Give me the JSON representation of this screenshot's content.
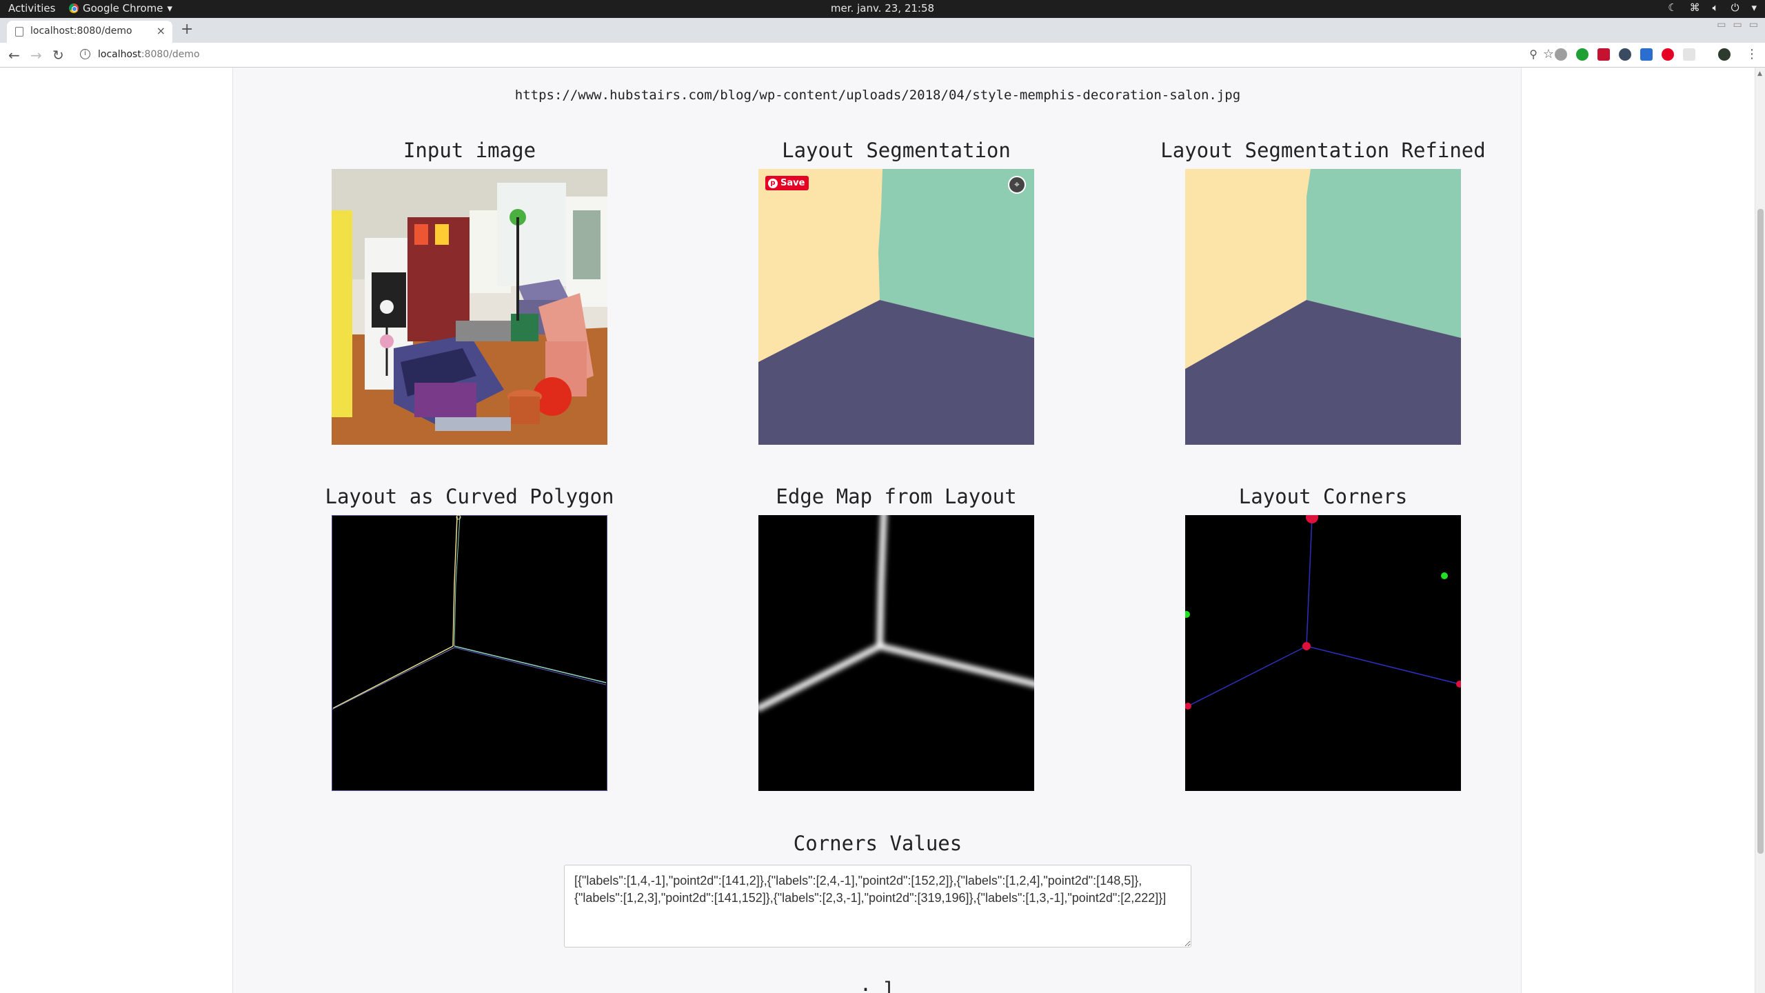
{
  "system_bar": {
    "activities": "Activities",
    "app_name": "Google Chrome",
    "clock": "mer. janv. 23, 21:58"
  },
  "browser": {
    "tab_title": "localhost:8080/demo",
    "url_host": "localhost",
    "url_rest": ":8080/demo"
  },
  "page": {
    "image_url": "https://www.hubstairs.com/blog/wp-content/uploads/2018/04/style-memphis-decoration-salon.jpg",
    "panels": {
      "input": "Input image",
      "seg": "Layout Segmentation",
      "seg_refined": "Layout Segmentation Refined",
      "curved": "Layout as Curved Polygon",
      "edge": "Edge Map from Layout",
      "corners": "Layout Corners"
    },
    "save_label": "Save",
    "corners_title": "Corners Values",
    "corners_values": "[{\"labels\":[1,4,-1],\"point2d\":[141,2]},{\"labels\":[2,4,-1],\"point2d\":[152,2]},{\"labels\":[1,2,4],\"point2d\":[148,5]},{\"labels\":[1,2,3],\"point2d\":[141,152]},{\"labels\":[2,3,-1],\"point2d\":[319,196]},{\"labels\":[1,3,-1],\"point2d\":[2,222]}]",
    "next_heading_partial": "· l"
  },
  "colors": {
    "wall_left": "#fce4a8",
    "wall_right": "#8ecdb2",
    "floor": "#545176",
    "corner_red": "#e0103c",
    "corner_green": "#22e022",
    "edge_blue": "#3030c0"
  }
}
